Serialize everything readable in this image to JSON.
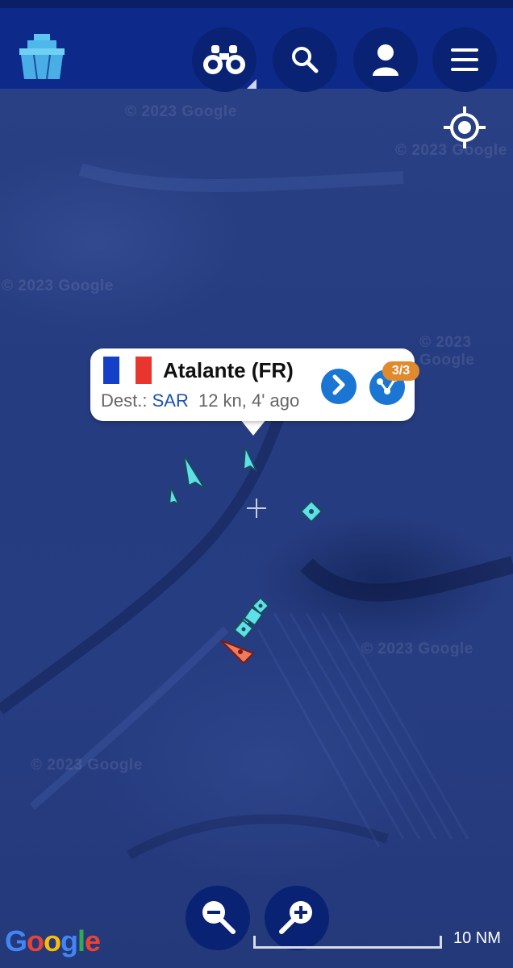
{
  "header": {
    "logo_icon": "ship-logo-icon",
    "buttons": [
      {
        "name": "binoculars-button",
        "icon": "binoculars-icon"
      },
      {
        "name": "search-button",
        "icon": "search-icon"
      },
      {
        "name": "account-button",
        "icon": "user-icon"
      },
      {
        "name": "menu-button",
        "icon": "hamburger-menu-icon"
      }
    ]
  },
  "map": {
    "watermark": "© 2023 Google",
    "locate_icon": "locate-icon",
    "attribution_logo": "Google",
    "scale_label": "10 NM"
  },
  "popup": {
    "flag_colors": [
      "#1440c8",
      "#ffffff",
      "#e8362e"
    ],
    "vessel_name": "Atalante (FR)",
    "dest_label": "Dest.:",
    "destination": "SAR",
    "speed_age": "12 kn, 4' ago",
    "count_badge": "3/3",
    "detail_icon": "chevron-right-icon",
    "multi_icon": "route-nodes-icon"
  },
  "colors": {
    "header_bg": "#0d2a8a",
    "vessel_marker": "#5de0e6",
    "selected_marker": "#f07a5e",
    "badge": "#e08a2e",
    "accent_button": "#1a76d2"
  },
  "zoom": {
    "zoom_out_icon": "zoom-out-icon",
    "zoom_in_icon": "zoom-in-icon"
  }
}
